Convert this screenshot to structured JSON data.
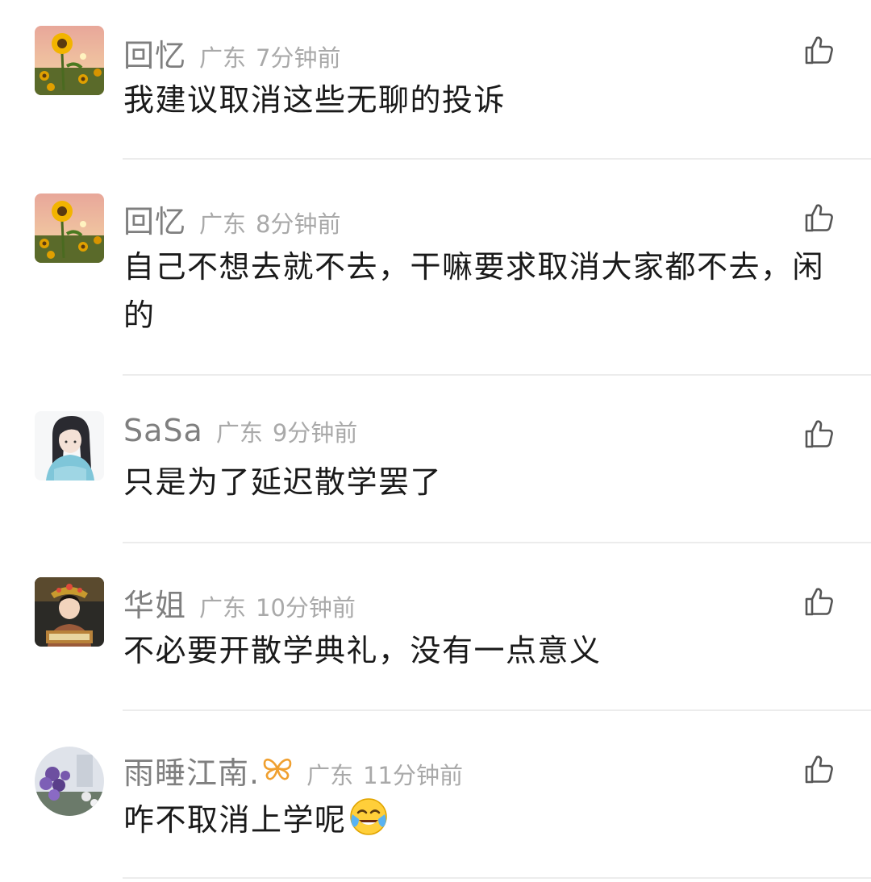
{
  "comments": [
    {
      "username": "回忆",
      "location": "广东",
      "time": "7分钟前",
      "text": "我建议取消这些无聊的投诉",
      "avatar_icon": "sunflower-avatar-icon"
    },
    {
      "username": "回忆",
      "location": "广东",
      "time": "8分钟前",
      "text": "自己不想去就不去，干嘛要求取消大家都不去，闲的",
      "avatar_icon": "sunflower-avatar-icon"
    },
    {
      "username": "SaSa",
      "location": "广东",
      "time": "9分钟前",
      "text": "只是为了延迟散学罢了",
      "avatar_icon": "anime-girl-avatar-icon"
    },
    {
      "username": "华姐",
      "location": "广东",
      "time": "10分钟前",
      "text": "不必要开散学典礼，没有一点意义",
      "avatar_icon": "child-costume-avatar-icon"
    },
    {
      "username": "雨睡江南.",
      "location": "广东",
      "time": "11分钟前",
      "text": "咋不取消上学呢",
      "avatar_icon": "purple-flowers-avatar-icon",
      "badge_icon": "butterfly-badge-icon",
      "emoji": "crying-laughing-emoji-icon"
    }
  ],
  "icons": {
    "like": "thumbs-up-icon"
  },
  "colors": {
    "username": "#7f7f7f",
    "meta": "#a9a9a9",
    "text": "#1a1a1a",
    "badge": "#f0a030"
  }
}
